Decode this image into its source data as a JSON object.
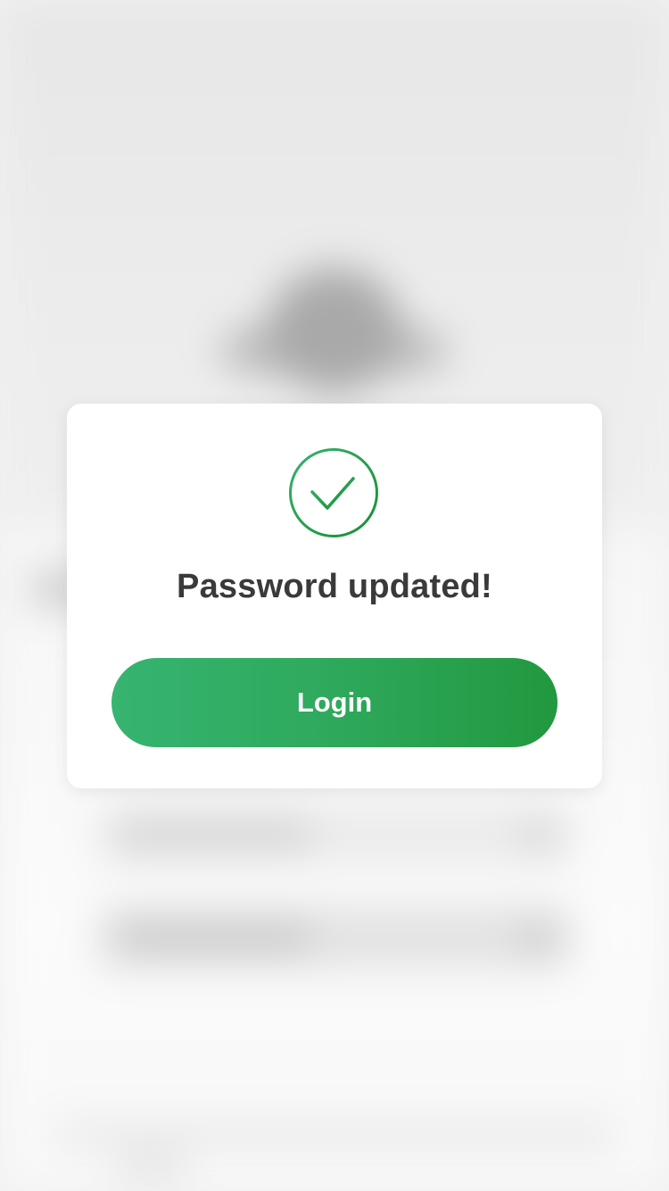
{
  "dialog": {
    "icon": "check-circle-icon",
    "title": "Password updated!",
    "button_label": "Login"
  },
  "colors": {
    "accent_start": "#36b470",
    "accent_end": "#22983f",
    "check_stroke": "#1f9a3d",
    "title_text": "#3a3a3a",
    "card_background": "#ffffff"
  }
}
